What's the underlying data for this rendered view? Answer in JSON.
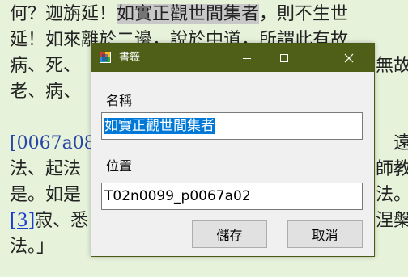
{
  "document": {
    "lines": [
      {
        "pre": "何？迦旃延！",
        "highlight": "如實正觀世間集者",
        "post": "，則不生世"
      },
      {
        "text": "延！如來離於二邊，說於中道，所謂此有故"
      },
      {
        "left": "病、死、",
        "right": "無故"
      },
      {
        "left": "老、病、",
        "right": ""
      },
      {
        "ref": "[0067a08]",
        "right": "遠"
      },
      {
        "left": "法、起法",
        "right": "師教"
      },
      {
        "left": "是。如是",
        "right": "法。"
      },
      {
        "link": "[3]",
        "left": "寂、悉",
        "right": "涅槃"
      },
      {
        "text": "法。」"
      }
    ]
  },
  "dialog": {
    "title": "書籤",
    "name_label": "名稱",
    "name_value": "如實正觀世間集者",
    "position_label": "位置",
    "position_value": "T02n0099_p0067a02",
    "save_button": "儲存",
    "cancel_button": "取消"
  }
}
